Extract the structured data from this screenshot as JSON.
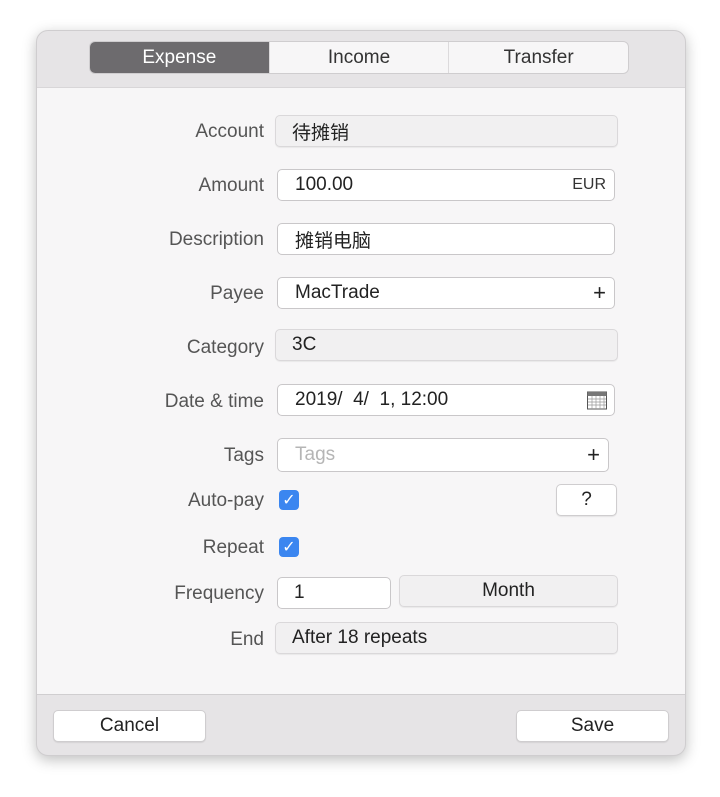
{
  "tabs": [
    {
      "label": "Expense",
      "active": true
    },
    {
      "label": "Income"
    },
    {
      "label": "Transfer"
    }
  ],
  "form": {
    "account": {
      "label": "Account",
      "value": "待摊销"
    },
    "amount": {
      "label": "Amount",
      "value": "100.00",
      "currency": "EUR"
    },
    "description": {
      "label": "Description",
      "value": "摊销电脑"
    },
    "payee": {
      "label": "Payee",
      "value": "MacTrade",
      "add": "+"
    },
    "category": {
      "label": "Category",
      "value": "3C"
    },
    "datetime": {
      "label": "Date & time",
      "value": "2019/  4/  1, 12:00",
      "icon": "calendar-icon"
    },
    "tags": {
      "label": "Tags",
      "placeholder": "Tags",
      "add": "+"
    },
    "autopay": {
      "label": "Auto-pay",
      "checked": true,
      "help": "?"
    },
    "repeat": {
      "label": "Repeat",
      "checked": true
    },
    "frequency": {
      "label": "Frequency",
      "value": "1",
      "unit": "Month"
    },
    "end": {
      "label": "End",
      "value": "After 18 repeats"
    }
  },
  "footer": {
    "cancel": "Cancel",
    "save": "Save"
  },
  "colors": {
    "accent": "#3b86f0",
    "segment_active": "#6d6b6e"
  }
}
